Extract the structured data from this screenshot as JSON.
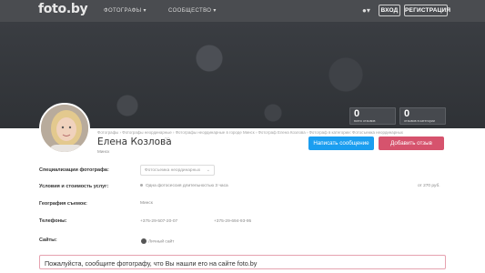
{
  "header": {
    "logo": "foto.by",
    "nav": {
      "photos": "ФОТОГРАФЫ ▾",
      "community": "СООБЩЕСТВО ▾"
    },
    "lang": "●▾",
    "login_label": "ВХОД",
    "register_label": "РЕГИСТРАЦИЯ"
  },
  "stats": [
    {
      "value": "0",
      "label": "всего отзывов"
    },
    {
      "value": "0",
      "label": "отзывов в категории"
    }
  ],
  "breadcrumbs": "Фотографы › Фотографы неординарные › Фотографы неординарные в городе Минск › Фотограф Елена Козлова › Фотограф в категории: Фотосъемка неординарных",
  "profile": {
    "name": "Елена Козлова",
    "city": "Минск"
  },
  "actions": {
    "message_label": "Написать сообщение",
    "review_label": "Добавить отзыв"
  },
  "details": {
    "specialization_label": "Специализации фотографа:",
    "specialization_value": "Фотосъемка неординарных",
    "services_label": "Условия и стоимость услуг:",
    "services_value": "Одна фотосессия длительностью 3 часа",
    "services_price": "от 270 руб.",
    "geo_label": "География съемок:",
    "geo_value": "Минск",
    "phones_label": "Телефоны:",
    "phone_1": "+375-29-507-20-07",
    "phone_2": "+375-29-694-93-95",
    "sites_label": "Сайты:",
    "site_value": "Личный сайт"
  },
  "notice": "Пожалуйста, сообщите фотографу, что Вы нашли его на сайте foto.by",
  "colors": {
    "topbar": "#4a4c50",
    "message_button": "#1b9ef0",
    "review_button": "#d6536d",
    "notice_border": "#e6a2b0"
  },
  "icons": {
    "heart": "heart-icon",
    "globe": "globe-icon",
    "language": "globe-icon"
  }
}
